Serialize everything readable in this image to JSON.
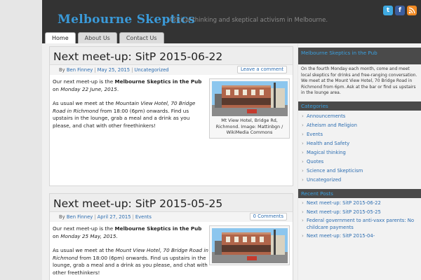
{
  "site": {
    "title": "Melbourne Skeptics",
    "tagline": "Critical thinking and skeptical activism in Melbourne."
  },
  "social": [
    {
      "name": "twitter-icon",
      "glyph": "t",
      "color": "#3fa9e0"
    },
    {
      "name": "facebook-icon",
      "glyph": "f",
      "color": "#3b5e9f"
    },
    {
      "name": "rss-icon",
      "glyph": "◗",
      "color": "#f08a24"
    }
  ],
  "nav": {
    "home": "Home",
    "about": "About Us",
    "contact": "Contact Us"
  },
  "posts": [
    {
      "title": "Next meet-up: SitP 2015-06-22",
      "by": "By",
      "author": "Ben Finney",
      "date": "May 25, 2015",
      "category": "Uncategorized",
      "comment_label": "Leave a comment",
      "p1_a": "Our next meet-up is the ",
      "p1_b": "Melbourne Skeptics in the Pub",
      "p1_c": " on ",
      "p1_d": "Monday 22 June, 2015",
      "p1_e": ".",
      "p2_a": "As usual we meet at the ",
      "p2_b": "Mountain View Hotel, 70 Bridge Road in Richmond",
      "p2_c": " from 18:00 (6pm) onwards. Find us upstairs in the lounge, grab a meal and a drink as you please, and chat with other freethinkers!",
      "caption": "Mt View Hotel, Bridge Rd, Richmond. Image: Mattinbgn / WikiMedia Commons"
    },
    {
      "title": "Next meet-up: SitP 2015-05-25",
      "by": "By",
      "author": "Ben Finney",
      "date": "April 27, 2015",
      "category": "Events",
      "comment_label": "0 Comments",
      "p1_a": "Our next meet-up is the ",
      "p1_b": "Melbourne Skeptics in the Pub",
      "p1_c": " on ",
      "p1_d": "Monday 25 May, 2015",
      "p1_e": ".",
      "p2_a": "As usual we meet at the ",
      "p2_b": "Mount View Hotel, 70 Bridge Road in Richmond",
      "p2_c": " from 18:00 (6pm) onwards. Find us upstairs in the lounge, grab a meal and a drink as you please, and chat with other freethinkers!",
      "caption": ""
    }
  ],
  "sidebar": {
    "pub_title": "Melbourne Skeptics in the Pub",
    "pub_text": "On the fourth Monday each month, come and meet local skeptics for drinks and free-ranging conversation. We meet at the Mount View Hotel, 70 Bridge Road in Richmond from 6pm. Ask at the bar or find us upstairs in the lounge area.",
    "categories_title": "Categories",
    "categories": [
      "Announcements",
      "Atheism and Religion",
      "Events",
      "Health and Safety",
      "Magical thinking",
      "Quotes",
      "Science and Skepticism",
      "Uncategorized"
    ],
    "recent_title": "Recent Posts",
    "recent": [
      "Next meet-up: SitP 2015-06-22",
      "Next meet-up: SitP 2015-05-25",
      "Federal government to anti-vaxx parents: No childcare payments",
      "Next meet-up: SitP 2015-04-"
    ]
  },
  "colors": {
    "accent": "#3a9ad9",
    "header_bg": "#333333",
    "link": "#2b6cb0"
  }
}
